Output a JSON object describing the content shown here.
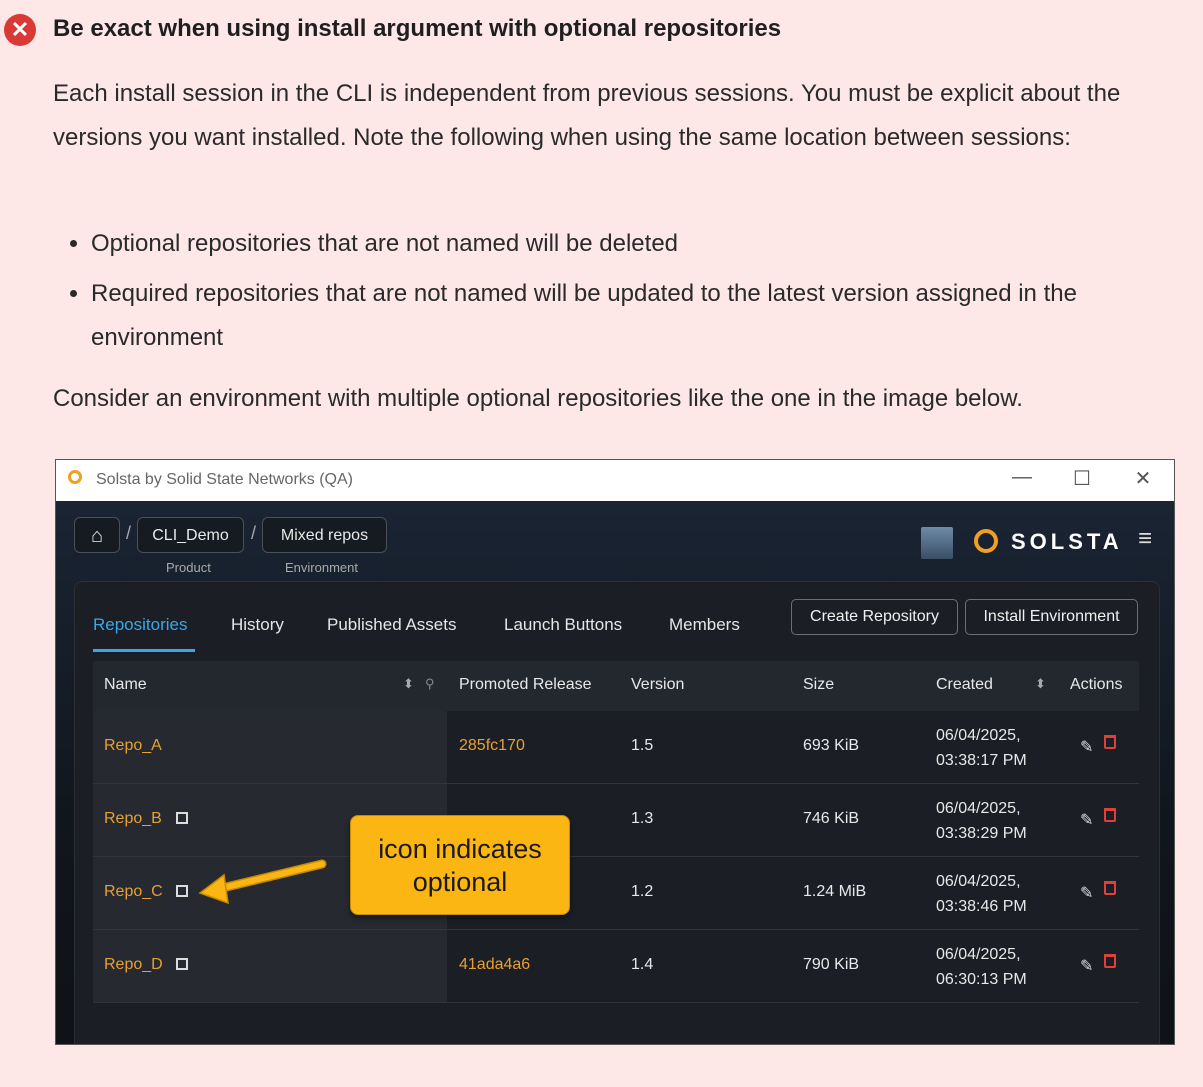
{
  "heading": "Be exact when using install argument with optional repositories",
  "para1": "Each install session in the CLI is independent from previous sessions. You must be explicit about the versions you want installed. Note the following when using the same location between sessions:",
  "bullets": [
    "Optional repositories that are not named will be deleted",
    "Required repositories that are not named will be updated to the latest version assigned in the environment"
  ],
  "para2": "Consider an environment with multiple optional repositories like the one in the image below.",
  "window": {
    "title": "Solsta by Solid State Networks (QA)",
    "minimize": "—",
    "maximize": "☐",
    "close": "✕"
  },
  "breadcrumb": {
    "home_icon": "⌂",
    "sep": "/",
    "product": "CLI_Demo",
    "product_label": "Product",
    "environment": "Mixed repos",
    "environment_label": "Environment"
  },
  "brand": "SOLSTA",
  "menu_icon": "≡",
  "tabs": [
    "Repositories",
    "History",
    "Published Assets",
    "Launch Buttons",
    "Members"
  ],
  "buttons": {
    "create": "Create Repository",
    "install": "Install Environment"
  },
  "columns": [
    "Name",
    "Promoted Release",
    "Version",
    "Size",
    "Created",
    "Actions"
  ],
  "rows": [
    {
      "name": "Repo_A",
      "release": "285fc170",
      "version": "1.5",
      "size": "693 KiB",
      "date": "06/04/2025,",
      "time": "03:38:17 PM"
    },
    {
      "name": "Repo_B",
      "release": "",
      "version": "1.3",
      "size": "746 KiB",
      "date": "06/04/2025,",
      "time": "03:38:29 PM"
    },
    {
      "name": "Repo_C",
      "release": "",
      "version": "1.2",
      "size": "1.24 MiB",
      "date": "06/04/2025,",
      "time": "03:38:46 PM"
    },
    {
      "name": "Repo_D",
      "release": "41ada4a6",
      "version": "1.4",
      "size": "790 KiB",
      "date": "06/04/2025,",
      "time": "06:30:13 PM"
    }
  ],
  "callout": {
    "line1": "icon indicates",
    "line2": "optional"
  },
  "colors": {
    "accent": "#3ba6e6",
    "orange": "#e8a030",
    "callout": "#fbb614",
    "error": "#d93a36"
  }
}
